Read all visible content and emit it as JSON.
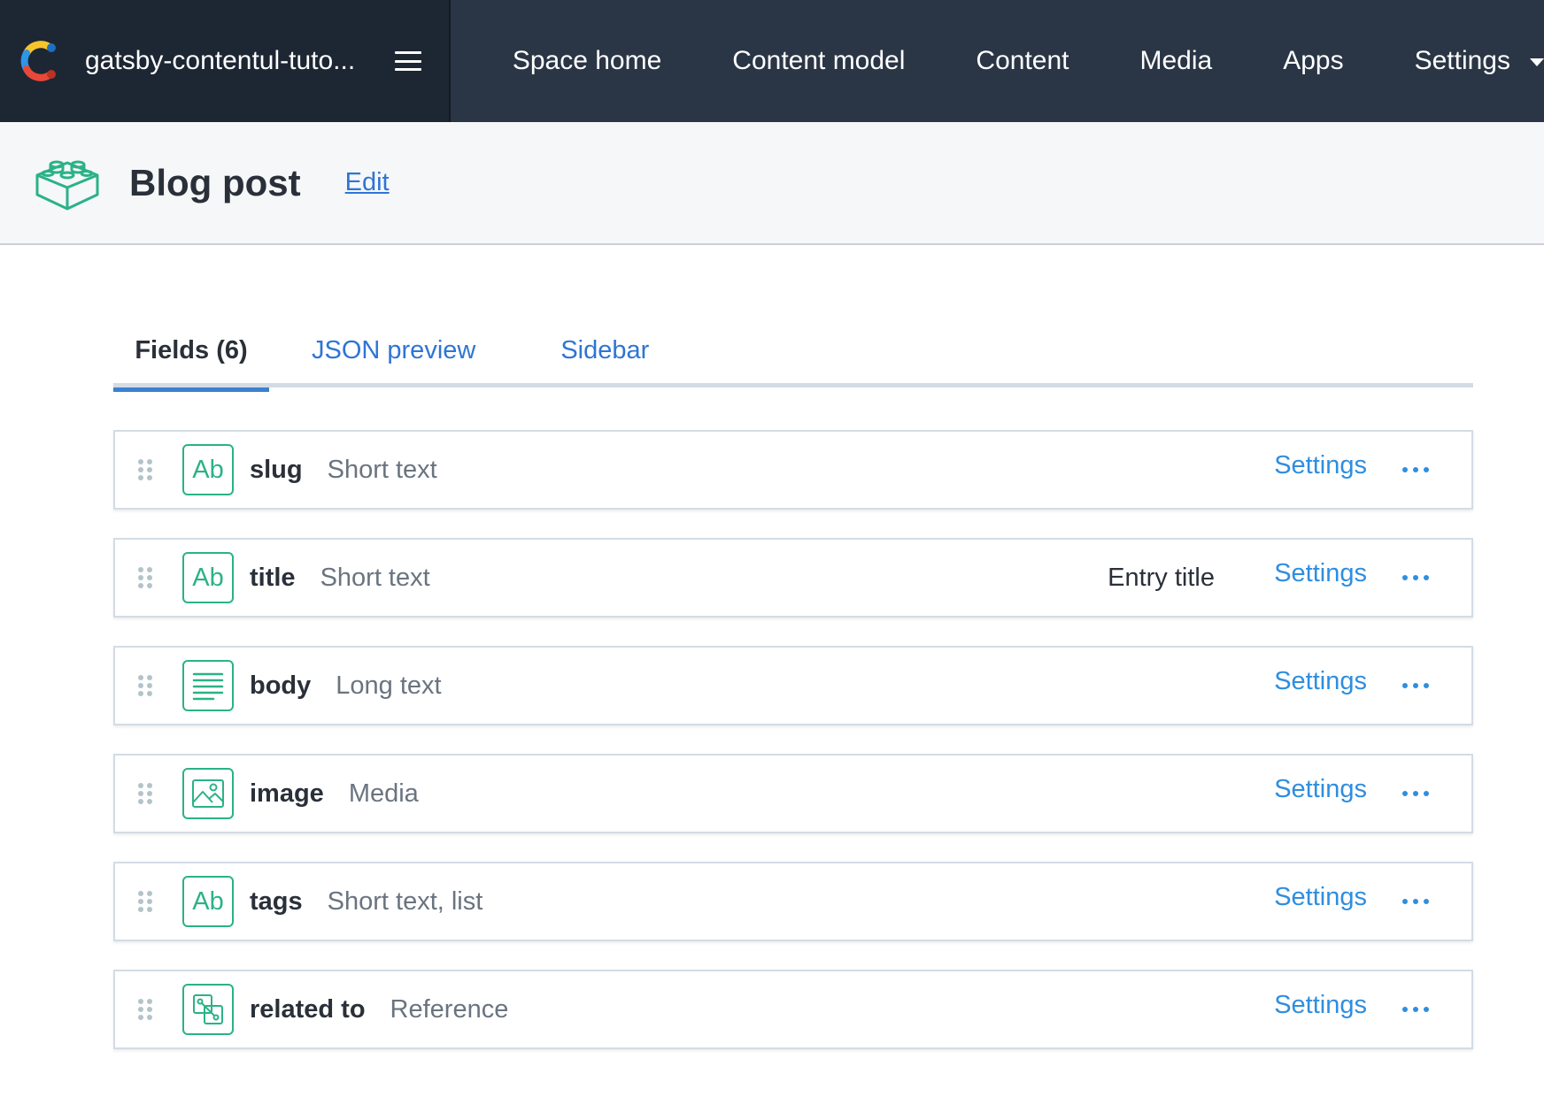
{
  "topbar": {
    "space_name": "gatsby-contentul-tuto...",
    "nav": [
      "Space home",
      "Content model",
      "Content",
      "Media",
      "Apps",
      "Settings"
    ]
  },
  "header": {
    "title": "Blog post",
    "edit_label": "Edit"
  },
  "tabs": [
    {
      "label": "Fields (6)",
      "active": true
    },
    {
      "label": "JSON preview",
      "active": false
    },
    {
      "label": "Sidebar",
      "active": false
    }
  ],
  "fields": [
    {
      "name": "slug",
      "type": "Short text",
      "icon": "short-text-icon",
      "entry_title": "",
      "settings_label": "Settings"
    },
    {
      "name": "title",
      "type": "Short text",
      "icon": "short-text-icon",
      "entry_title": "Entry title",
      "settings_label": "Settings"
    },
    {
      "name": "body",
      "type": "Long text",
      "icon": "long-text-icon",
      "entry_title": "",
      "settings_label": "Settings"
    },
    {
      "name": "image",
      "type": "Media",
      "icon": "media-icon",
      "entry_title": "",
      "settings_label": "Settings"
    },
    {
      "name": "tags",
      "type": "Short text, list",
      "icon": "short-text-icon",
      "entry_title": "",
      "settings_label": "Settings"
    },
    {
      "name": "related to",
      "type": "Reference",
      "icon": "reference-icon",
      "entry_title": "",
      "settings_label": "Settings"
    }
  ],
  "colors": {
    "nav_bg": "#2a3545",
    "switcher_bg": "#1d2633",
    "accent_green": "#2bb287",
    "link_blue": "#2e8ee0"
  }
}
